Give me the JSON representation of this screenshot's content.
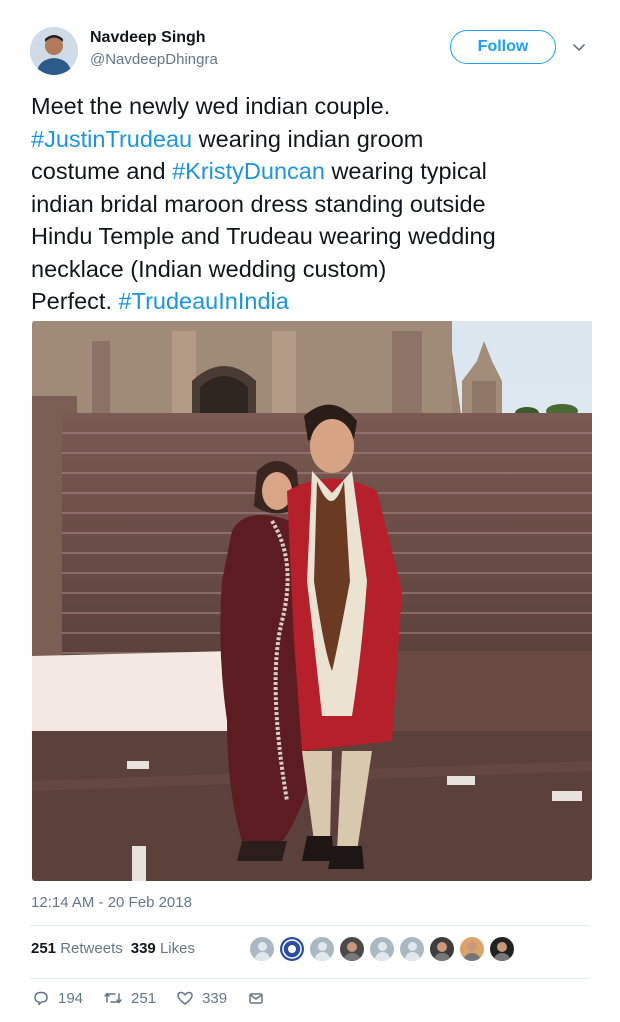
{
  "author": {
    "name": "Navdeep Singh",
    "handle": "@NavdeepDhingra"
  },
  "follow_label": "Follow",
  "tweet_lines": [
    [
      "Meet the newly wed indian couple."
    ],
    [
      "#JustinTrudeau",
      " wearing indian groom"
    ],
    [
      "costume and ",
      "#KristyDuncan",
      " wearing typical"
    ],
    [
      "indian bridal maroon dress standing outside"
    ],
    [
      "Hindu Temple and Trudeau wearing wedding"
    ],
    [
      "necklace (Indian wedding custom)"
    ],
    [
      "Perfect. ",
      "#TrudeauInIndia"
    ]
  ],
  "timestamp": "12:14 AM - 20 Feb 2018",
  "stats": {
    "retweets_count": "251",
    "retweets_label": "Retweets",
    "likes_count": "339",
    "likes_label": "Likes"
  },
  "likers": [
    {
      "icon": "default-avatar"
    },
    {
      "icon": "emblem-avatar",
      "color": "#2d4fa1"
    },
    {
      "icon": "default-avatar"
    },
    {
      "icon": "photo-avatar",
      "color": "#4a4a4a"
    },
    {
      "icon": "default-avatar"
    },
    {
      "icon": "default-avatar"
    },
    {
      "icon": "photo-avatar",
      "color": "#3d3d3d"
    },
    {
      "icon": "photo-avatar",
      "color": "#d9a36b"
    },
    {
      "icon": "photo-avatar",
      "color": "#222222"
    }
  ],
  "actions": {
    "replies": "194",
    "retweets": "251",
    "likes": "339"
  },
  "colors": {
    "accent": "#1da1f2",
    "hashtag": "#1b95e0",
    "muted": "#657786"
  }
}
